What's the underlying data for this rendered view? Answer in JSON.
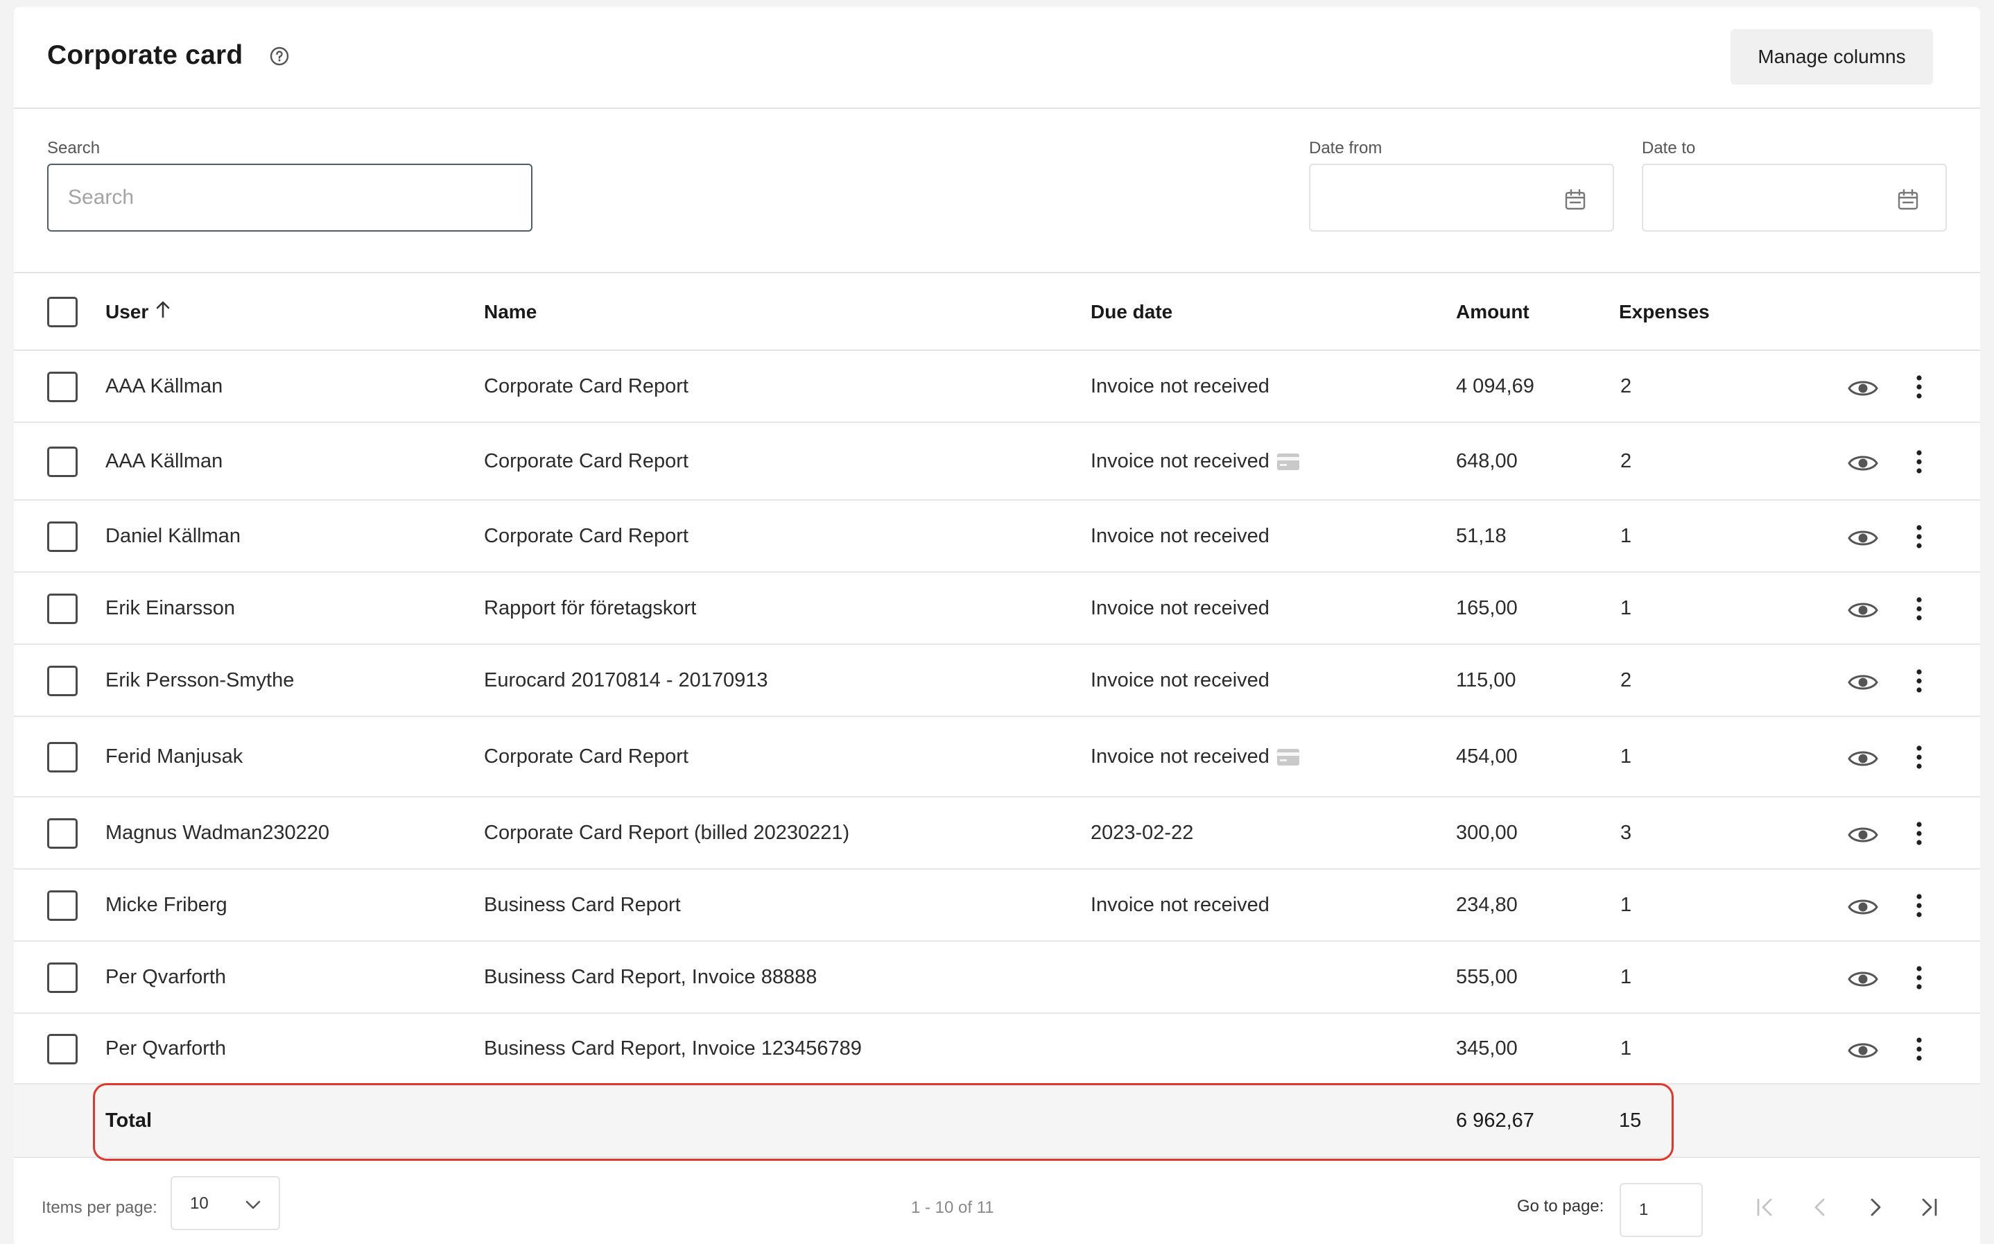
{
  "header": {
    "title": "Corporate card",
    "manage_columns_label": "Manage columns"
  },
  "filters": {
    "search_label": "Search",
    "search_placeholder": "Search",
    "date_from_label": "Date from",
    "date_to_label": "Date to"
  },
  "table": {
    "columns": {
      "user": "User",
      "name": "Name",
      "due_date": "Due date",
      "amount": "Amount",
      "expenses": "Expenses"
    },
    "sort": {
      "column": "user",
      "direction": "ascending"
    },
    "rows": [
      {
        "user": "AAA Källman",
        "name": "Corporate Card Report",
        "due_date": "Invoice not received",
        "card_icon": false,
        "amount": "4 094,69",
        "expenses": "2"
      },
      {
        "user": "AAA Källman",
        "name": "Corporate Card Report",
        "due_date": "Invoice not received",
        "card_icon": true,
        "amount": "648,00",
        "expenses": "2"
      },
      {
        "user": "Daniel Källman",
        "name": "Corporate Card Report",
        "due_date": "Invoice not received",
        "card_icon": false,
        "amount": "51,18",
        "expenses": "1"
      },
      {
        "user": "Erik Einarsson",
        "name": "Rapport för företagskort",
        "due_date": "Invoice not received",
        "card_icon": false,
        "amount": "165,00",
        "expenses": "1"
      },
      {
        "user": "Erik Persson-Smythe",
        "name": "Eurocard 20170814 - 20170913",
        "due_date": "Invoice not received",
        "card_icon": false,
        "amount": "115,00",
        "expenses": "2"
      },
      {
        "user": "Ferid Manjusak",
        "name": "Corporate Card Report",
        "due_date": "Invoice not received",
        "card_icon": true,
        "amount": "454,00",
        "expenses": "1"
      },
      {
        "user": "Magnus Wadman230220",
        "name": "Corporate Card Report (billed 20230221)",
        "due_date": "2023-02-22",
        "card_icon": false,
        "amount": "300,00",
        "expenses": "3"
      },
      {
        "user": "Micke Friberg",
        "name": "Business Card Report",
        "due_date": "Invoice not received",
        "card_icon": false,
        "amount": "234,80",
        "expenses": "1"
      },
      {
        "user": "Per Qvarforth",
        "name": "Business Card Report, Invoice 88888",
        "due_date": "",
        "card_icon": false,
        "amount": "555,00",
        "expenses": "1"
      },
      {
        "user": "Per Qvarforth",
        "name": "Business Card Report, Invoice 123456789",
        "due_date": "",
        "card_icon": false,
        "amount": "345,00",
        "expenses": "1"
      }
    ],
    "total": {
      "label": "Total",
      "amount": "6 962,67",
      "expenses": "15"
    }
  },
  "pagination": {
    "items_per_page_label": "Items per page:",
    "items_per_page_value": "10",
    "range_text": "1 - 10 of 11",
    "go_to_page_label": "Go to page:",
    "go_to_page_value": "1"
  },
  "colors": {
    "highlight": "#e0372c",
    "search_border": "#4f5e66",
    "total_background": "#f5f5f5"
  },
  "icons": [
    "help-icon",
    "calendar-icon",
    "sort-ascending-icon",
    "card-icon",
    "eye-icon",
    "more-vertical-icon",
    "chevron-down-icon",
    "first-page-icon",
    "previous-page-icon",
    "next-page-icon",
    "last-page-icon"
  ]
}
